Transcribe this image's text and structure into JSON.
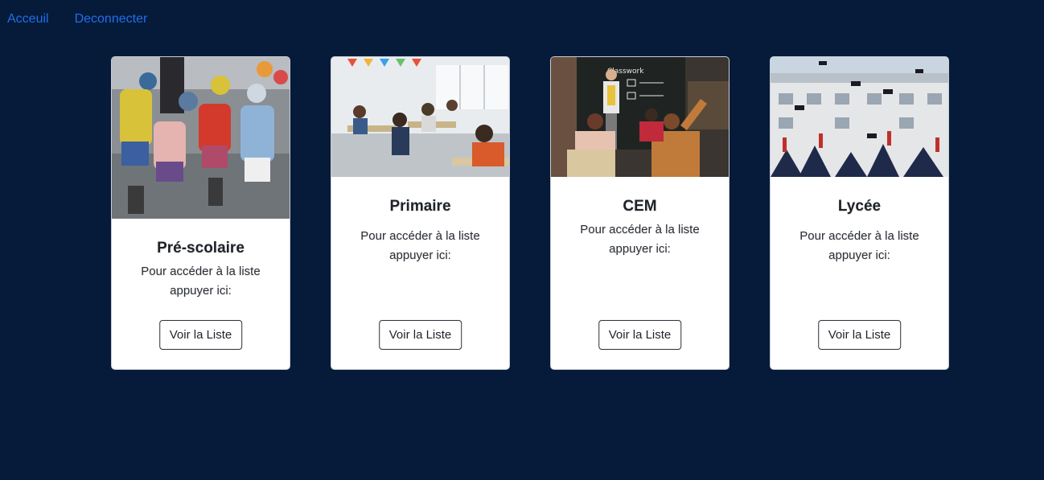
{
  "nav": {
    "home_label": "Acceuil",
    "logout_label": "Deconnecter"
  },
  "cards": [
    {
      "title": "Pré-scolaire",
      "text": "Pour accéder à la liste appuyer ici:",
      "button": "Voir la Liste"
    },
    {
      "title": "Primaire",
      "text": "Pour accéder à la liste appuyer ici:",
      "button": "Voir la Liste"
    },
    {
      "title": "CEM",
      "text": "Pour accéder à la liste appuyer ici:",
      "button": "Voir la Liste"
    },
    {
      "title": "Lycée",
      "text": "Pour accéder à la liste appuyer ici:",
      "button": "Voir la Liste"
    }
  ],
  "colors": {
    "background": "#061a3a",
    "link": "#1f6feb",
    "card": "#ffffff"
  }
}
